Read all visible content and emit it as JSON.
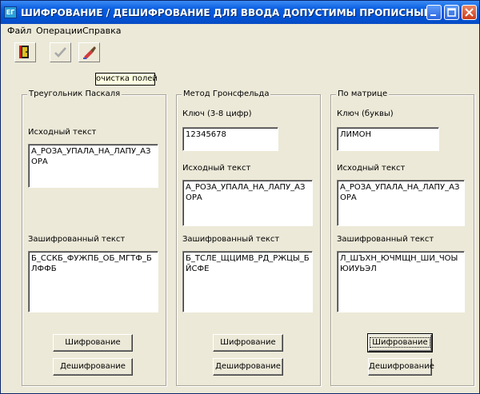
{
  "window": {
    "title": "ШИФРОВАНИЕ / ДЕШИФРОВАНИЕ    ДЛЯ ВВОДА ДОПУСТИМЫ ПРОПИСНЫЕ РУССКИЕ ..."
  },
  "menu": [
    "Файл",
    "Операции",
    "Справка"
  ],
  "toolbar": {
    "buttons": [
      {
        "icon": "exit-door-icon"
      },
      {
        "icon": "checkmark-icon"
      },
      {
        "icon": "eraser-brush-icon"
      }
    ],
    "tooltip": "очистка полей"
  },
  "groups": [
    {
      "title": "Треугольник Паскаля",
      "source_label": "Исходный текст",
      "source_text": "А_РОЗА_УПАЛА_НА_ЛАПУ_АЗОРА",
      "cipher_label": "Зашифрованный текст",
      "cipher_text": "Б_ССКБ_ФУЖПБ_ОБ_МГТФ_БЛФФБ",
      "encrypt_label": "Шифрование",
      "decrypt_label": "Дешифрование"
    },
    {
      "title": "Метод Гронсфельда",
      "key_label": "Ключ (3-8 цифр)",
      "key_value": "12345678",
      "source_label": "Исходный текст",
      "source_text": "А_РОЗА_УПАЛА_НА_ЛАПУ_АЗОРА",
      "cipher_label": "Зашифрованный текст",
      "cipher_text": "Б_ТСЛЕ_ЩЦИМВ_РД_РЖЦЫ_БЙСФЕ",
      "encrypt_label": "Шифрование",
      "decrypt_label": "Дешифрование"
    },
    {
      "title": "По матрице",
      "key_label": "Ключ (буквы)",
      "key_value": "ЛИМОН",
      "source_label": "Исходный текст",
      "source_text": "А_РОЗА_УПАЛА_НА_ЛАПУ_АЗОРА",
      "cipher_label": "Зашифрованный текст",
      "cipher_text": "Л_ШЪХН_ЮЧМЩН_ШИ_ЧОЫЮИУЬЭЛ",
      "encrypt_label": "Шифрование",
      "decrypt_label": "Дешифрование"
    }
  ]
}
